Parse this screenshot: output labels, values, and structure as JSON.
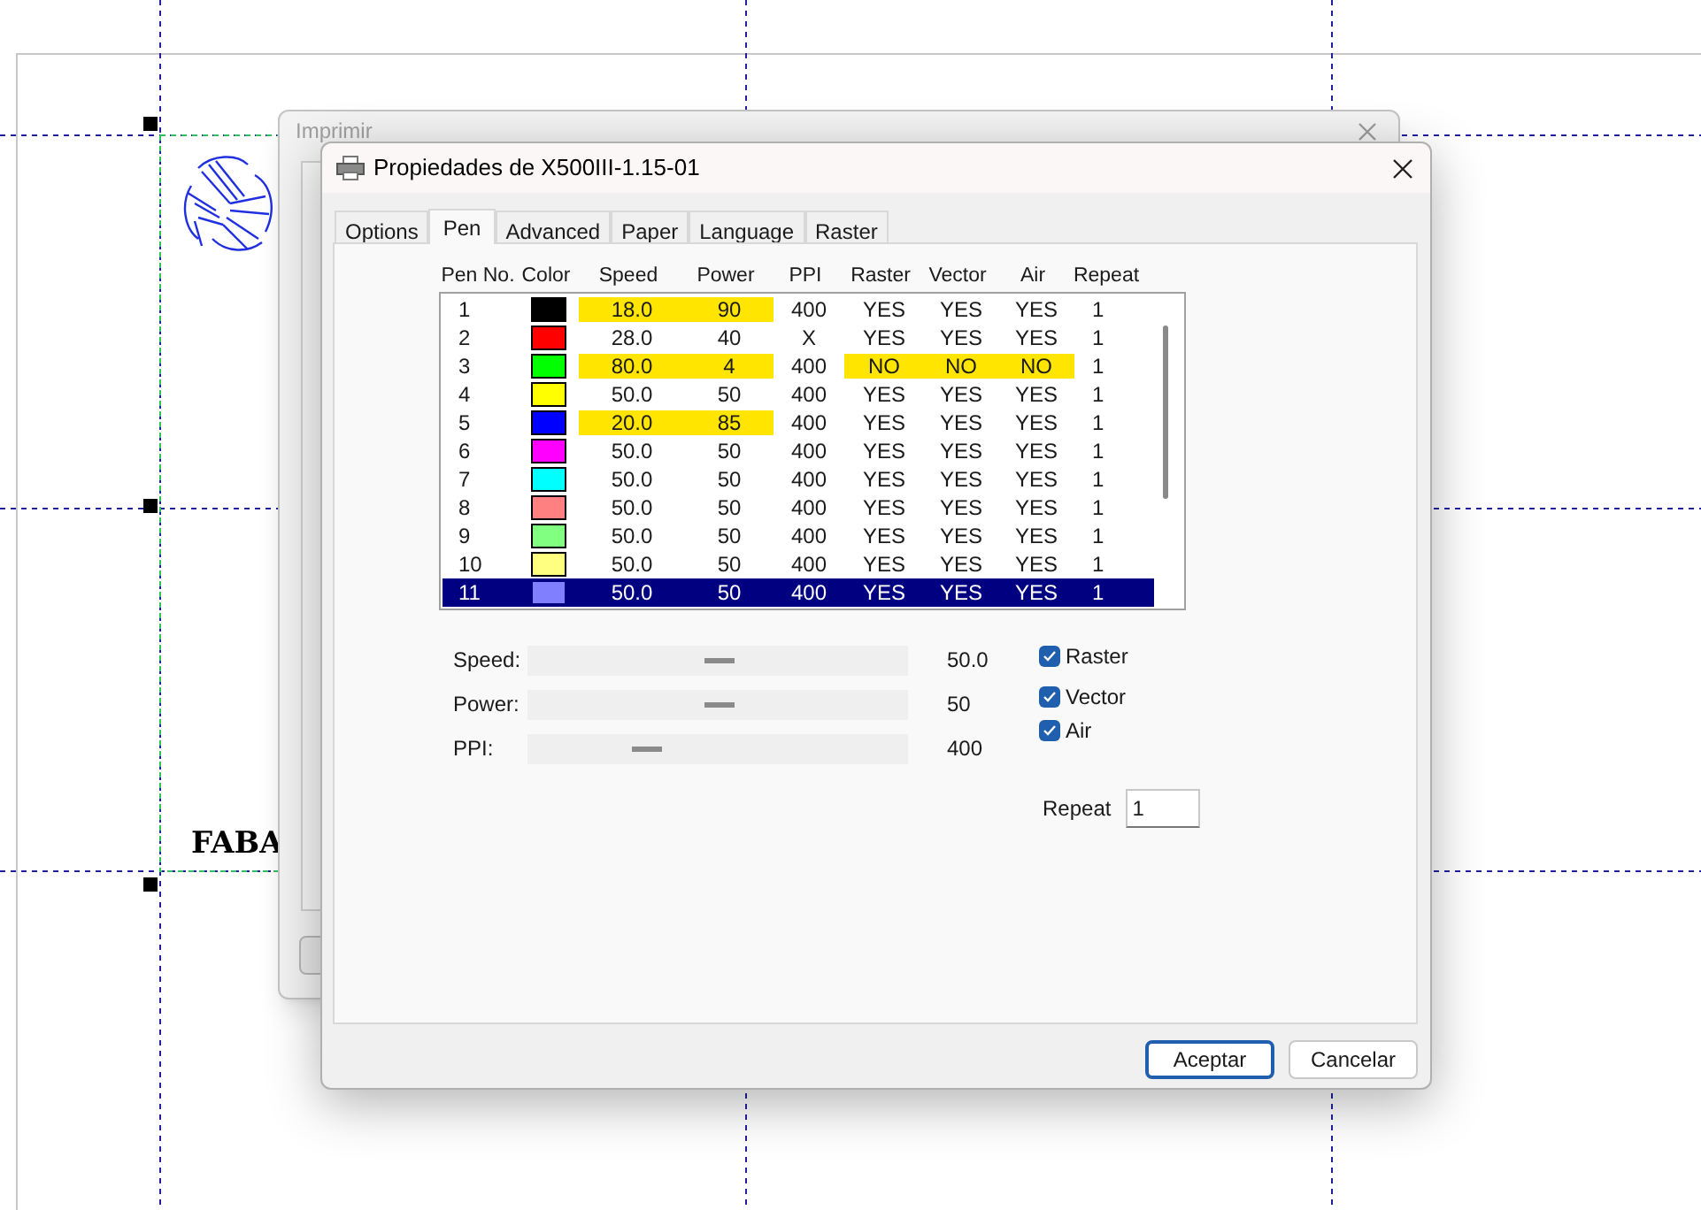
{
  "canvas": {
    "text": "FABA"
  },
  "back_dialog": {
    "title": "Imprimir"
  },
  "dialog": {
    "title": "Propiedades de X500III-1.15-01",
    "tabs": [
      {
        "label": "Options",
        "selected": false
      },
      {
        "label": "Pen",
        "selected": true
      },
      {
        "label": "Advanced",
        "selected": false
      },
      {
        "label": "Paper",
        "selected": false
      },
      {
        "label": "Language",
        "selected": false
      },
      {
        "label": "Raster",
        "selected": false
      }
    ],
    "pen_table": {
      "columns": [
        "Pen No.",
        "Color",
        "Speed",
        "Power",
        "PPI",
        "Raster",
        "Vector",
        "Air",
        "Repeat"
      ],
      "rows": [
        {
          "selected": false,
          "cells": [
            {
              "kind": "text",
              "text": "1",
              "highlighted": false
            },
            {
              "kind": "swatch",
              "color": "#000000"
            },
            {
              "kind": "text",
              "text": "18.0",
              "highlighted": true
            },
            {
              "kind": "text",
              "text": "90",
              "highlighted": true
            },
            {
              "kind": "text",
              "text": "400",
              "highlighted": false
            },
            {
              "kind": "text",
              "text": "YES",
              "highlighted": false
            },
            {
              "kind": "text",
              "text": "YES",
              "highlighted": false
            },
            {
              "kind": "text",
              "text": "YES",
              "highlighted": false
            },
            {
              "kind": "text",
              "text": "1",
              "highlighted": false
            }
          ]
        },
        {
          "selected": false,
          "cells": [
            {
              "kind": "text",
              "text": "2",
              "highlighted": false
            },
            {
              "kind": "swatch",
              "color": "#ff0000"
            },
            {
              "kind": "text",
              "text": "28.0",
              "highlighted": false
            },
            {
              "kind": "text",
              "text": "40",
              "highlighted": false
            },
            {
              "kind": "text",
              "text": "X",
              "highlighted": false
            },
            {
              "kind": "text",
              "text": "YES",
              "highlighted": false
            },
            {
              "kind": "text",
              "text": "YES",
              "highlighted": false
            },
            {
              "kind": "text",
              "text": "YES",
              "highlighted": false
            },
            {
              "kind": "text",
              "text": "1",
              "highlighted": false
            }
          ]
        },
        {
          "selected": false,
          "cells": [
            {
              "kind": "text",
              "text": "3",
              "highlighted": false
            },
            {
              "kind": "swatch",
              "color": "#00ff00"
            },
            {
              "kind": "text",
              "text": "80.0",
              "highlighted": true
            },
            {
              "kind": "text",
              "text": "4",
              "highlighted": true
            },
            {
              "kind": "text",
              "text": "400",
              "highlighted": false
            },
            {
              "kind": "text",
              "text": "NO",
              "highlighted": true
            },
            {
              "kind": "text",
              "text": "NO",
              "highlighted": true
            },
            {
              "kind": "text",
              "text": "NO",
              "highlighted": true
            },
            {
              "kind": "text",
              "text": "1",
              "highlighted": false
            }
          ]
        },
        {
          "selected": false,
          "cells": [
            {
              "kind": "text",
              "text": "4",
              "highlighted": false
            },
            {
              "kind": "swatch",
              "color": "#ffff00"
            },
            {
              "kind": "text",
              "text": "50.0",
              "highlighted": false
            },
            {
              "kind": "text",
              "text": "50",
              "highlighted": false
            },
            {
              "kind": "text",
              "text": "400",
              "highlighted": false
            },
            {
              "kind": "text",
              "text": "YES",
              "highlighted": false
            },
            {
              "kind": "text",
              "text": "YES",
              "highlighted": false
            },
            {
              "kind": "text",
              "text": "YES",
              "highlighted": false
            },
            {
              "kind": "text",
              "text": "1",
              "highlighted": false
            }
          ]
        },
        {
          "selected": false,
          "cells": [
            {
              "kind": "text",
              "text": "5",
              "highlighted": false
            },
            {
              "kind": "swatch",
              "color": "#0000ff"
            },
            {
              "kind": "text",
              "text": "20.0",
              "highlighted": true
            },
            {
              "kind": "text",
              "text": "85",
              "highlighted": true
            },
            {
              "kind": "text",
              "text": "400",
              "highlighted": false
            },
            {
              "kind": "text",
              "text": "YES",
              "highlighted": false
            },
            {
              "kind": "text",
              "text": "YES",
              "highlighted": false
            },
            {
              "kind": "text",
              "text": "YES",
              "highlighted": false
            },
            {
              "kind": "text",
              "text": "1",
              "highlighted": false
            }
          ]
        },
        {
          "selected": false,
          "cells": [
            {
              "kind": "text",
              "text": "6",
              "highlighted": false
            },
            {
              "kind": "swatch",
              "color": "#ff00ff"
            },
            {
              "kind": "text",
              "text": "50.0",
              "highlighted": false
            },
            {
              "kind": "text",
              "text": "50",
              "highlighted": false
            },
            {
              "kind": "text",
              "text": "400",
              "highlighted": false
            },
            {
              "kind": "text",
              "text": "YES",
              "highlighted": false
            },
            {
              "kind": "text",
              "text": "YES",
              "highlighted": false
            },
            {
              "kind": "text",
              "text": "YES",
              "highlighted": false
            },
            {
              "kind": "text",
              "text": "1",
              "highlighted": false
            }
          ]
        },
        {
          "selected": false,
          "cells": [
            {
              "kind": "text",
              "text": "7",
              "highlighted": false
            },
            {
              "kind": "swatch",
              "color": "#00ffff"
            },
            {
              "kind": "text",
              "text": "50.0",
              "highlighted": false
            },
            {
              "kind": "text",
              "text": "50",
              "highlighted": false
            },
            {
              "kind": "text",
              "text": "400",
              "highlighted": false
            },
            {
              "kind": "text",
              "text": "YES",
              "highlighted": false
            },
            {
              "kind": "text",
              "text": "YES",
              "highlighted": false
            },
            {
              "kind": "text",
              "text": "YES",
              "highlighted": false
            },
            {
              "kind": "text",
              "text": "1",
              "highlighted": false
            }
          ]
        },
        {
          "selected": false,
          "cells": [
            {
              "kind": "text",
              "text": "8",
              "highlighted": false
            },
            {
              "kind": "swatch",
              "color": "#ff8080"
            },
            {
              "kind": "text",
              "text": "50.0",
              "highlighted": false
            },
            {
              "kind": "text",
              "text": "50",
              "highlighted": false
            },
            {
              "kind": "text",
              "text": "400",
              "highlighted": false
            },
            {
              "kind": "text",
              "text": "YES",
              "highlighted": false
            },
            {
              "kind": "text",
              "text": "YES",
              "highlighted": false
            },
            {
              "kind": "text",
              "text": "YES",
              "highlighted": false
            },
            {
              "kind": "text",
              "text": "1",
              "highlighted": false
            }
          ]
        },
        {
          "selected": false,
          "cells": [
            {
              "kind": "text",
              "text": "9",
              "highlighted": false
            },
            {
              "kind": "swatch",
              "color": "#80ff80"
            },
            {
              "kind": "text",
              "text": "50.0",
              "highlighted": false
            },
            {
              "kind": "text",
              "text": "50",
              "highlighted": false
            },
            {
              "kind": "text",
              "text": "400",
              "highlighted": false
            },
            {
              "kind": "text",
              "text": "YES",
              "highlighted": false
            },
            {
              "kind": "text",
              "text": "YES",
              "highlighted": false
            },
            {
              "kind": "text",
              "text": "YES",
              "highlighted": false
            },
            {
              "kind": "text",
              "text": "1",
              "highlighted": false
            }
          ]
        },
        {
          "selected": false,
          "cells": [
            {
              "kind": "text",
              "text": "10",
              "highlighted": false
            },
            {
              "kind": "swatch",
              "color": "#ffff80"
            },
            {
              "kind": "text",
              "text": "50.0",
              "highlighted": false
            },
            {
              "kind": "text",
              "text": "50",
              "highlighted": false
            },
            {
              "kind": "text",
              "text": "400",
              "highlighted": false
            },
            {
              "kind": "text",
              "text": "YES",
              "highlighted": false
            },
            {
              "kind": "text",
              "text": "YES",
              "highlighted": false
            },
            {
              "kind": "text",
              "text": "YES",
              "highlighted": false
            },
            {
              "kind": "text",
              "text": "1",
              "highlighted": false
            }
          ]
        },
        {
          "selected": true,
          "cells": [
            {
              "kind": "text",
              "text": "11",
              "highlighted": false
            },
            {
              "kind": "swatch",
              "color": "#8080ff"
            },
            {
              "kind": "text",
              "text": "50.0",
              "highlighted": false
            },
            {
              "kind": "text",
              "text": "50",
              "highlighted": false
            },
            {
              "kind": "text",
              "text": "400",
              "highlighted": false
            },
            {
              "kind": "text",
              "text": "YES",
              "highlighted": false
            },
            {
              "kind": "text",
              "text": "YES",
              "highlighted": false
            },
            {
              "kind": "text",
              "text": "YES",
              "highlighted": false
            },
            {
              "kind": "text",
              "text": "1",
              "highlighted": false
            }
          ]
        }
      ]
    },
    "sliders": [
      {
        "label": "Speed:",
        "level": 0.5,
        "reading": "50.0"
      },
      {
        "label": "Power:",
        "level": 0.5,
        "reading": "50"
      },
      {
        "label": "PPI:",
        "level": 0.31,
        "reading": "400"
      }
    ],
    "checkboxes": [
      {
        "label": "Raster",
        "checked": true
      },
      {
        "label": "Vector",
        "checked": true
      },
      {
        "label": "Air",
        "checked": true
      }
    ],
    "repeat": {
      "label": "Repeat",
      "value": "1"
    },
    "buttons": [
      {
        "label": "Aceptar",
        "default": true
      },
      {
        "label": "Cancelar",
        "default": false
      }
    ]
  }
}
